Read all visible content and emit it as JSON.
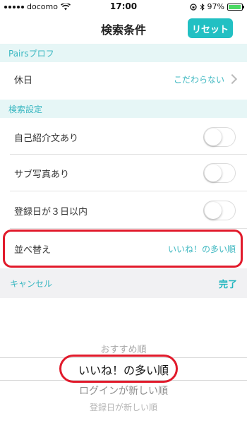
{
  "status_bar": {
    "carrier": "docomo",
    "time": "17:00",
    "battery_percent": "97%",
    "battery_level": 0.97
  },
  "nav": {
    "title": "検索条件",
    "reset_label": "リセット"
  },
  "sections": [
    {
      "header": "Pairsプロフ",
      "rows": [
        {
          "label": "休日",
          "value": "こだわらない"
        }
      ]
    },
    {
      "header": "検索設定",
      "rows": [
        {
          "label": "自己紹介文あり",
          "toggle": false
        },
        {
          "label": "サブ写真あり",
          "toggle": false
        },
        {
          "label": "登録日が３日以内",
          "toggle": false
        },
        {
          "label": "並べ替え",
          "value": "いいね！の多い順"
        }
      ]
    }
  ],
  "picker_toolbar": {
    "cancel_label": "キャンセル",
    "done_label": "完了"
  },
  "picker": {
    "options": [
      "おすすめ順",
      "いいね！の多い順",
      "ログインが新しい順",
      "登録日が新しい順"
    ],
    "selected_index": 1
  },
  "colors": {
    "accent": "#22c0c3",
    "section_bg": "#e6f6f6",
    "highlight": "#e11a2b"
  }
}
